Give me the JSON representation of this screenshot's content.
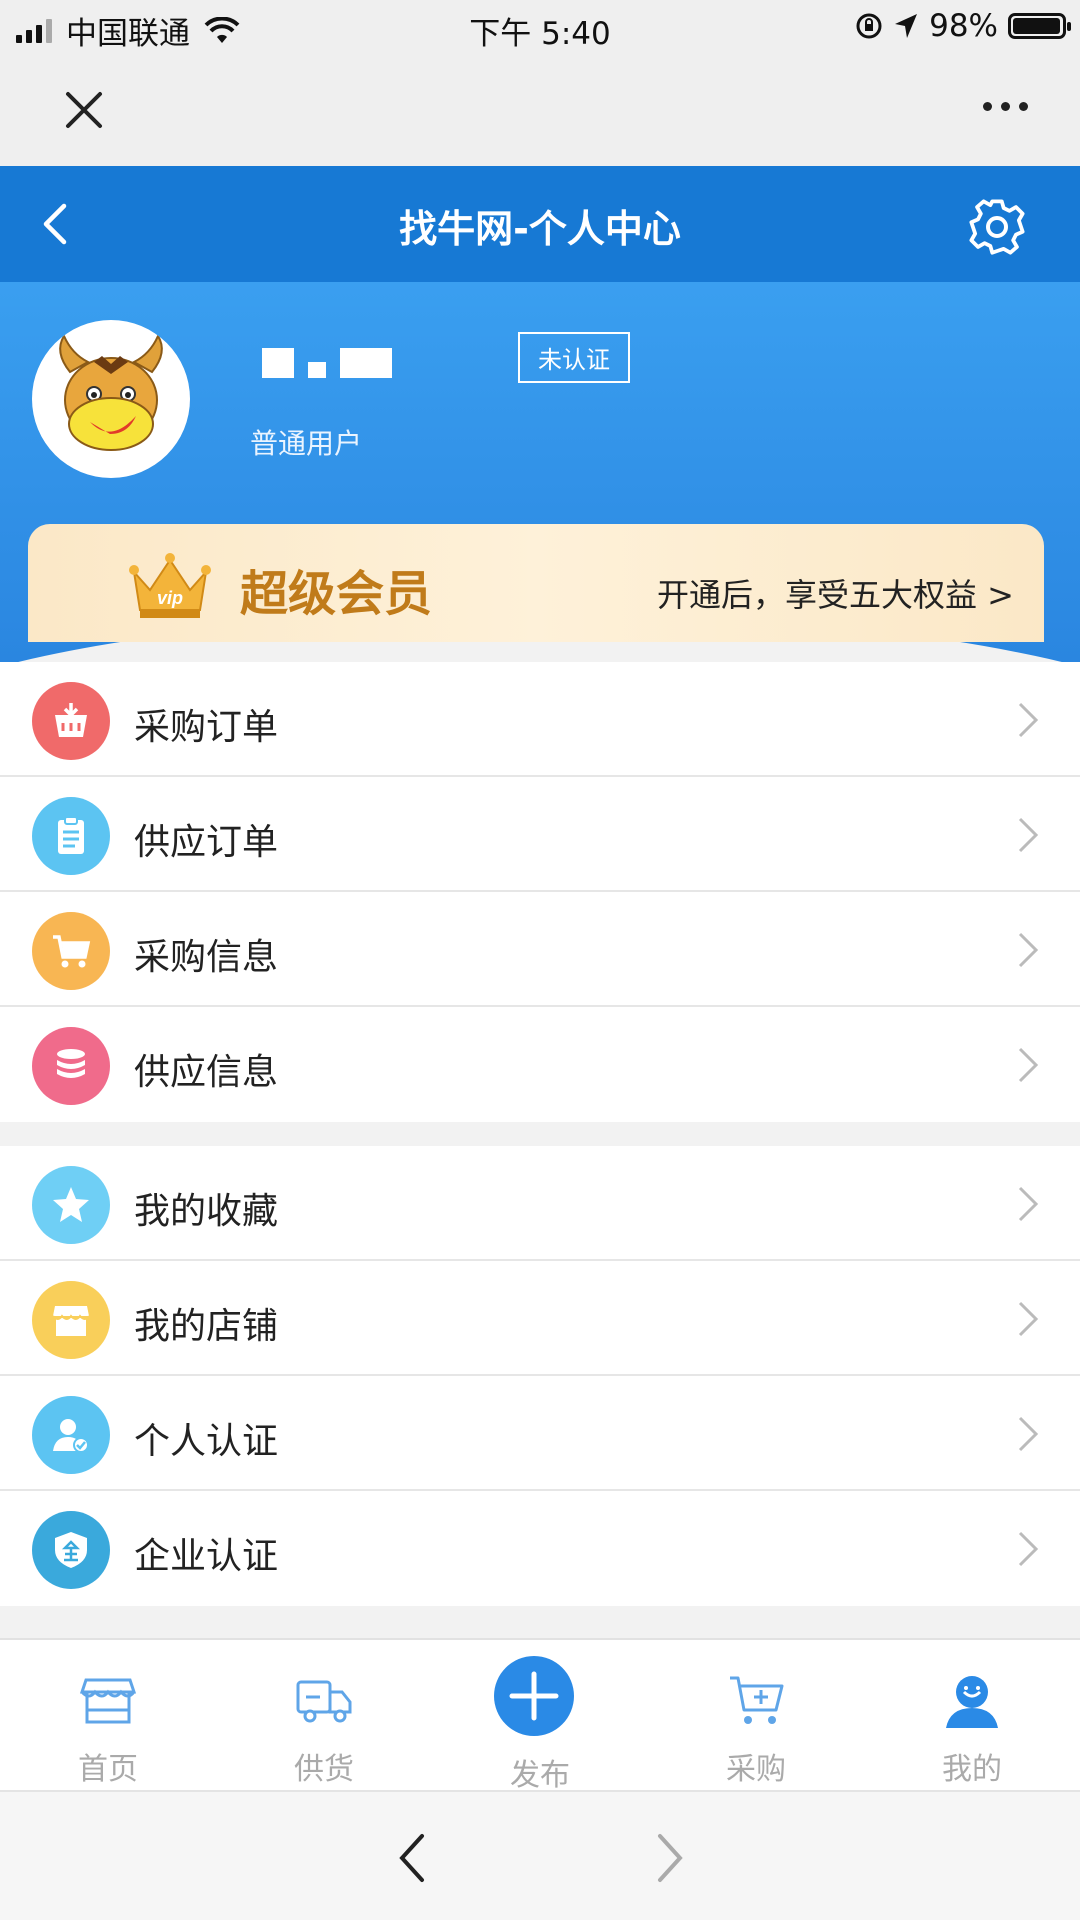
{
  "status": {
    "carrier": "中国联通",
    "time": "下午 5:40",
    "battery": "98%",
    "battery_level": 0.98
  },
  "nav": {
    "title": "找牛网-个人中心"
  },
  "profile": {
    "user_type": "普通用户",
    "verify_badge": "未认证"
  },
  "vip": {
    "title": "超级会员",
    "badge": "vip",
    "desc": "开通后，享受五大权益 >"
  },
  "menu_group_1": [
    {
      "label": "采购订单",
      "icon": "basket-icon",
      "color": "#f06a6a"
    },
    {
      "label": "供应订单",
      "icon": "clipboard-icon",
      "color": "#5cc4f2"
    },
    {
      "label": "采购信息",
      "icon": "cart-icon",
      "color": "#f8b653"
    },
    {
      "label": "供应信息",
      "icon": "coins-icon",
      "color": "#f06b8b"
    }
  ],
  "menu_group_2": [
    {
      "label": "我的收藏",
      "icon": "star-icon",
      "color": "#6fcff5"
    },
    {
      "label": "我的店铺",
      "icon": "store-icon",
      "color": "#f9cf5a"
    },
    {
      "label": "个人认证",
      "icon": "person-verify-icon",
      "color": "#5cc4f2"
    },
    {
      "label": "企业认证",
      "icon": "shield-icon",
      "color": "#3aa9dc"
    }
  ],
  "tabs": [
    {
      "label": "首页",
      "icon": "store-icon"
    },
    {
      "label": "供货",
      "icon": "truck-icon"
    },
    {
      "label": "发布",
      "icon": "plus-icon"
    },
    {
      "label": "采购",
      "icon": "cart-icon"
    },
    {
      "label": "我的",
      "icon": "user-icon"
    }
  ],
  "colors": {
    "nav": "#1779d4",
    "accent": "#2a8ae6",
    "vip_text": "#c07b1a"
  }
}
